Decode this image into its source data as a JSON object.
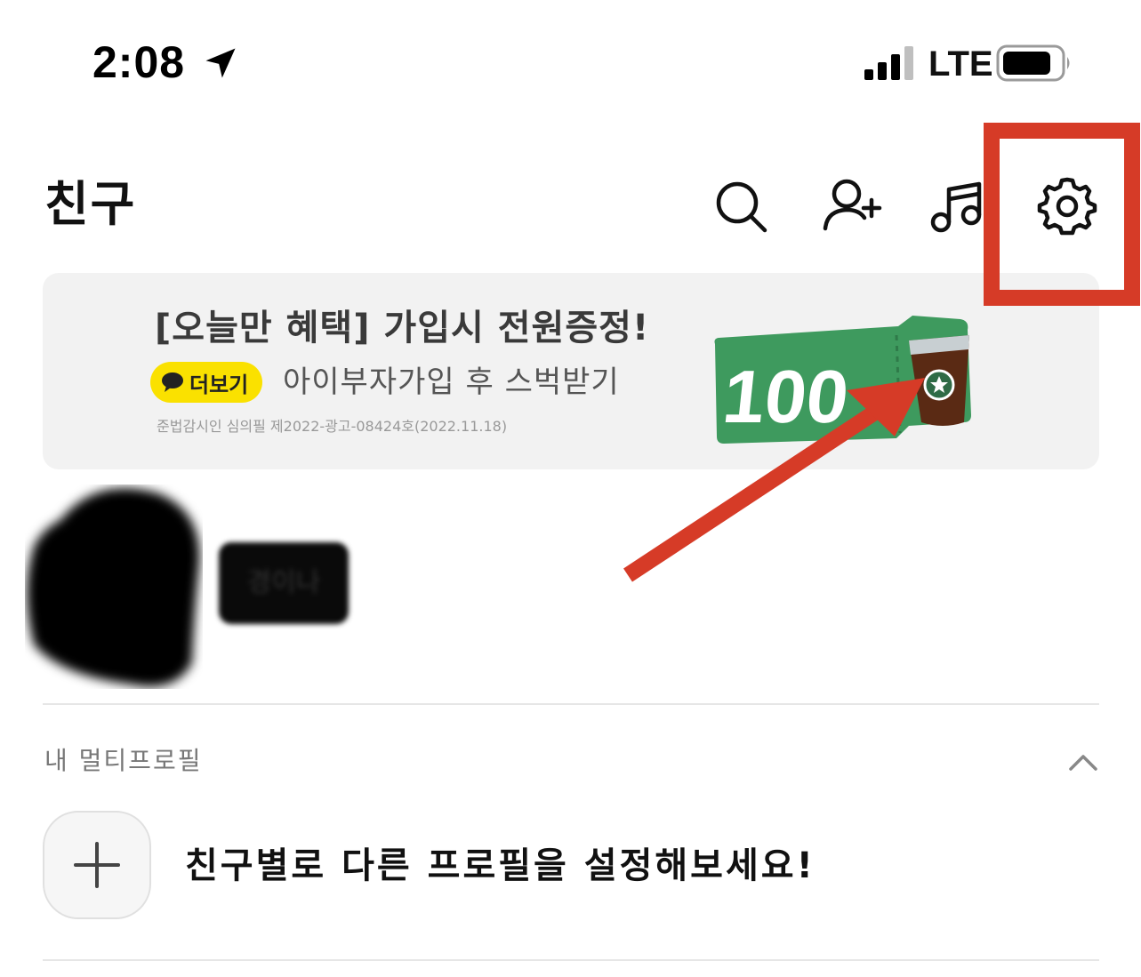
{
  "status_bar": {
    "time": "2:08",
    "network": "LTE",
    "battery_level": 0.85
  },
  "header": {
    "title": "친구",
    "icons": [
      "search-icon",
      "add-friend-icon",
      "music-icon",
      "settings-icon"
    ]
  },
  "banner": {
    "title": "[오늘만 혜택] 가입시 전원증정!",
    "more_label": "더보기",
    "subtitle": "아이부자가입 후 스벅받기",
    "legal": "준법감시인 심의필 제2022-광고-08424호(2022.11.18)",
    "coupon_text": "100"
  },
  "profile": {
    "name": "경이나"
  },
  "multi_profile": {
    "section_label": "내 멀티프로필",
    "add_prompt": "친구별로 다른 프로필을 설정해보세요!"
  },
  "annotation": {
    "color": "#d63b27"
  },
  "colors": {
    "kakao_yellow": "#fae100",
    "banner_bg": "#f2f2f2",
    "coupon_green": "#3e9a5e"
  }
}
